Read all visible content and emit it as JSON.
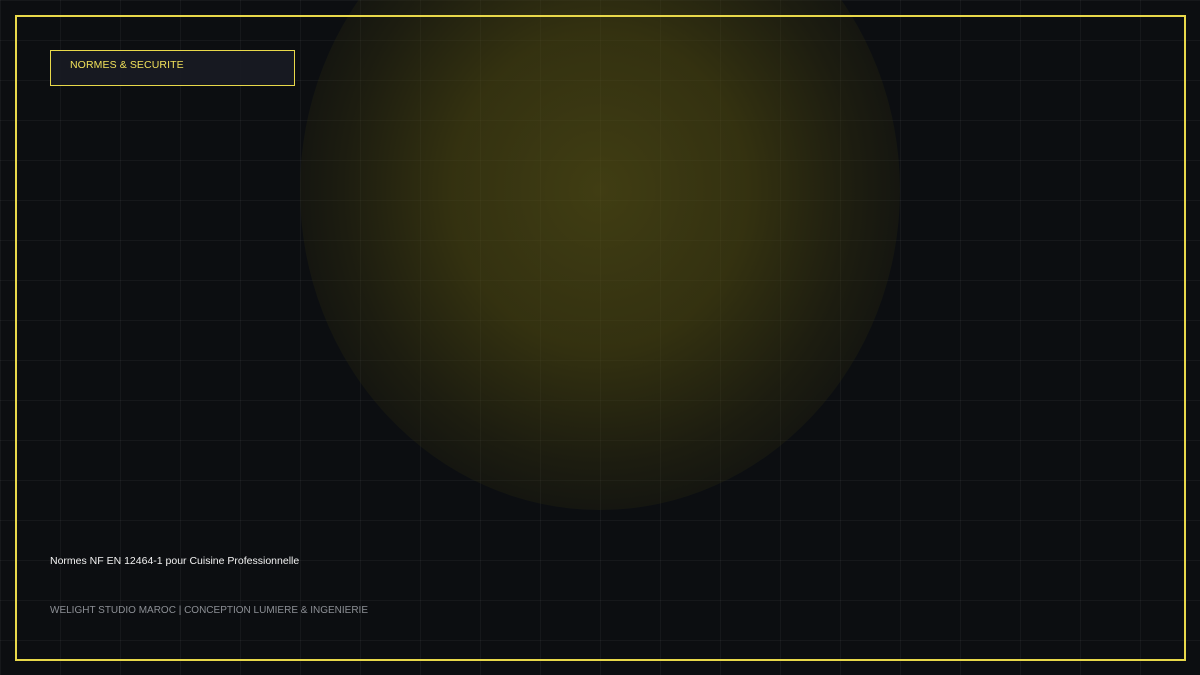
{
  "badge": {
    "label": "NORMES & SECURITE"
  },
  "content": {
    "subtitle": "Normes NF EN 12464-1 pour Cuisine Professionnelle"
  },
  "footer": {
    "text": "WELIGHT STUDIO MAROC | CONCEPTION LUMIERE & INGENIERIE"
  },
  "colors": {
    "accent": "#e8d84a",
    "background": "#0c0e11",
    "glow": "#5e5814",
    "footer_text": "#8c8f95"
  }
}
